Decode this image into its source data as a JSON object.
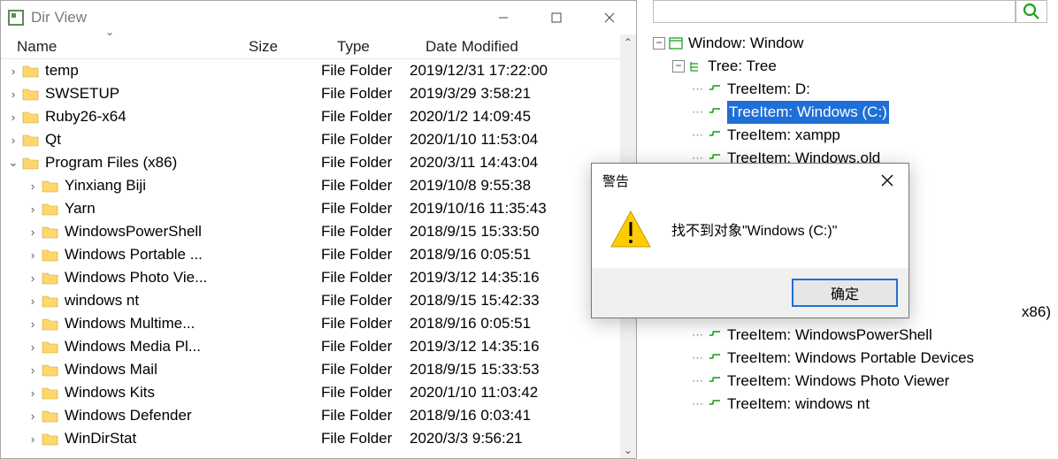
{
  "window": {
    "title": "Dir View",
    "columns": {
      "name": "Name",
      "size": "Size",
      "type": "Type",
      "date": "Date Modified"
    },
    "file_folder_label": "File Folder",
    "rows": [
      {
        "depth": 0,
        "twisty": "›",
        "name": "temp",
        "date": "2019/12/31 17:22:00"
      },
      {
        "depth": 0,
        "twisty": "›",
        "name": "SWSETUP",
        "date": "2019/3/29 3:58:21"
      },
      {
        "depth": 0,
        "twisty": "›",
        "name": "Ruby26-x64",
        "date": "2020/1/2 14:09:45"
      },
      {
        "depth": 0,
        "twisty": "›",
        "name": "Qt",
        "date": "2020/1/10 11:53:04"
      },
      {
        "depth": 0,
        "twisty": "⌄",
        "name": "Program Files (x86)",
        "date": "2020/3/11 14:43:04"
      },
      {
        "depth": 1,
        "twisty": "›",
        "name": "Yinxiang Biji",
        "date": "2019/10/8 9:55:38"
      },
      {
        "depth": 1,
        "twisty": "›",
        "name": "Yarn",
        "date": "2019/10/16 11:35:43"
      },
      {
        "depth": 1,
        "twisty": "›",
        "name": "WindowsPowerShell",
        "date": "2018/9/15 15:33:50"
      },
      {
        "depth": 1,
        "twisty": "›",
        "name": "Windows Portable ...",
        "date": "2018/9/16 0:05:51"
      },
      {
        "depth": 1,
        "twisty": "›",
        "name": "Windows Photo Vie...",
        "date": "2019/3/12 14:35:16"
      },
      {
        "depth": 1,
        "twisty": "›",
        "name": "windows nt",
        "date": "2018/9/15 15:42:33"
      },
      {
        "depth": 1,
        "twisty": "›",
        "name": "Windows Multime...",
        "date": "2018/9/16 0:05:51"
      },
      {
        "depth": 1,
        "twisty": "›",
        "name": "Windows Media Pl...",
        "date": "2019/3/12 14:35:16"
      },
      {
        "depth": 1,
        "twisty": "›",
        "name": "Windows Mail",
        "date": "2018/9/15 15:33:53"
      },
      {
        "depth": 1,
        "twisty": "›",
        "name": "Windows Kits",
        "date": "2020/1/10 11:03:42"
      },
      {
        "depth": 1,
        "twisty": "›",
        "name": "Windows Defender",
        "date": "2018/9/16 0:03:41"
      },
      {
        "depth": 1,
        "twisty": "›",
        "name": "WinDirStat",
        "date": "2020/3/3 9:56:21"
      }
    ]
  },
  "tree": {
    "nodes": [
      {
        "indent": 0,
        "expander": "-",
        "icon": "window",
        "label": "Window: Window"
      },
      {
        "indent": 1,
        "expander": "-",
        "icon": "tree",
        "label": "Tree: Tree"
      },
      {
        "indent": 2,
        "expander": "",
        "icon": "item",
        "label": "TreeItem: D:"
      },
      {
        "indent": 2,
        "expander": "",
        "icon": "item",
        "label": "TreeItem: Windows  (C:)",
        "selected": true
      },
      {
        "indent": 2,
        "expander": "",
        "icon": "item",
        "label": "TreeItem: xampp"
      },
      {
        "indent": 2,
        "expander": "",
        "icon": "item",
        "label": "TreeItem: Windows.old"
      },
      {
        "indent": 2,
        "expander": "",
        "icon": "item",
        "label": "x86)",
        "bare": true
      },
      {
        "indent": 2,
        "expander": "",
        "icon": "item",
        "label": "TreeItem: WindowsPowerShell",
        "partial": true
      },
      {
        "indent": 2,
        "expander": "",
        "icon": "item",
        "label": "TreeItem: Windows Portable Devices"
      },
      {
        "indent": 2,
        "expander": "",
        "icon": "item",
        "label": "TreeItem: Windows Photo Viewer"
      },
      {
        "indent": 2,
        "expander": "",
        "icon": "item",
        "label": "TreeItem: windows nt"
      }
    ]
  },
  "dialog": {
    "title": "警告",
    "message": "找不到对象\"Windows  (C:)\"",
    "ok": "确定"
  }
}
